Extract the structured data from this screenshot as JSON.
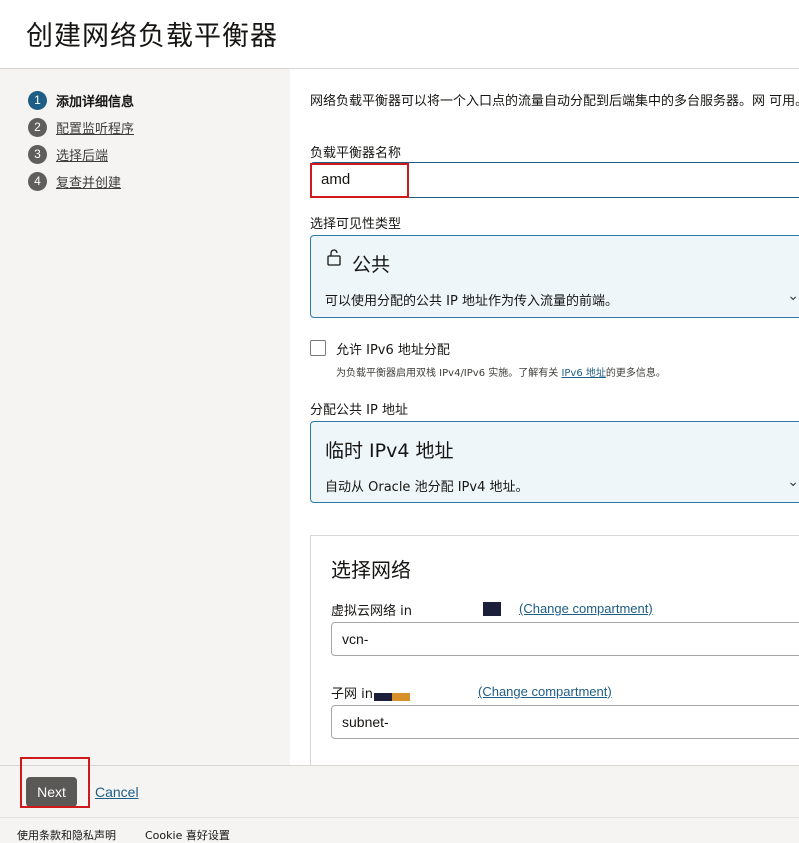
{
  "page": {
    "title": "创建网络负载平衡器"
  },
  "steps": [
    {
      "number": "1",
      "label": "添加详细信息",
      "active": true
    },
    {
      "number": "2",
      "label": "配置监听程序"
    },
    {
      "number": "3",
      "label": "选择后端"
    },
    {
      "number": "4",
      "label": "复查并创建"
    }
  ],
  "intro": {
    "text": "网络负载平衡器可以将一个入口点的流量自动分配到后端集中的多台服务器。网 可用。"
  },
  "name_field": {
    "label": "负载平衡器名称",
    "value": "amd"
  },
  "visibility": {
    "label": "选择可见性类型",
    "selected_title": "公共",
    "selected_desc": "可以使用分配的公共 IP 地址作为传入流量的前端。"
  },
  "ipv6": {
    "label": "允许 IPv6 地址分配",
    "help_prefix": "为负载平衡器启用双栈 IPv4/IPv6 实施。了解有关",
    "help_link": "IPv6 地址",
    "help_suffix": "的更多信息。"
  },
  "public_ip": {
    "label": "分配公共 IP 地址",
    "selected_title": "临时 IPv4 地址",
    "selected_desc": "自动从 Oracle 池分配 IPv4 地址。"
  },
  "network": {
    "title": "选择网络",
    "vcn_label": "虚拟云网络 in",
    "vcn_change": "(Change compartment)",
    "vcn_value": "vcn-",
    "subnet_label": "子网 in",
    "subnet_change": "(Change compartment)",
    "subnet_value": "subnet-"
  },
  "footer": {
    "next": "Next",
    "cancel": "Cancel"
  },
  "bottom": {
    "terms": "使用条款和隐私声明",
    "cookie": "Cookie 喜好设置"
  },
  "colors": {
    "accent": "#1e5d86",
    "highlight": "#d0191c",
    "card_bg": "#eef6f9"
  },
  "icons": {
    "visibility": "unlock-icon",
    "chevron": "chevron-down-icon"
  }
}
